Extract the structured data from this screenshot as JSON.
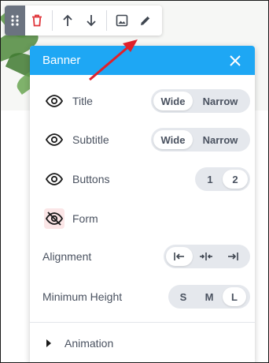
{
  "toolbar": {
    "icons": [
      "drag-handle-icon",
      "trash-icon",
      "arrow-up-icon",
      "arrow-down-icon",
      "image-icon",
      "pencil-icon"
    ],
    "delete_color": "#e0343a"
  },
  "panel": {
    "title": "Banner",
    "header_color": "#1ea7f4",
    "rows": {
      "title": {
        "label": "Title",
        "options": [
          "Wide",
          "Narrow"
        ],
        "selected": "Wide"
      },
      "subtitle": {
        "label": "Subtitle",
        "options": [
          "Wide",
          "Narrow"
        ],
        "selected": "Wide"
      },
      "buttons": {
        "label": "Buttons",
        "options": [
          "1",
          "2"
        ],
        "selected": "2"
      },
      "form": {
        "label": "Form",
        "visible": false
      }
    },
    "alignment": {
      "label": "Alignment",
      "options": [
        "align-left-icon",
        "align-center-icon",
        "align-right-icon"
      ],
      "selected": "align-left-icon"
    },
    "min_height": {
      "label": "Minimum Height",
      "options": [
        "S",
        "M",
        "L"
      ],
      "selected": "L"
    },
    "animation": {
      "label": "Animation"
    }
  },
  "annotation_color": "#e0202a"
}
